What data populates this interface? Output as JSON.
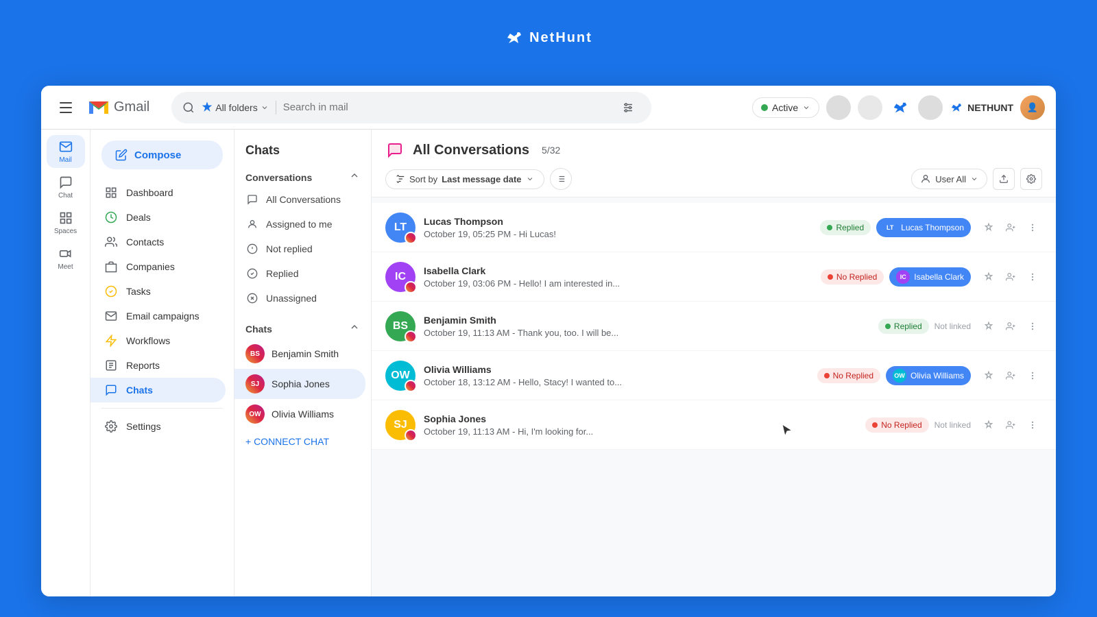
{
  "app": {
    "name": "NetHunt",
    "gmail_label": "Gmail"
  },
  "topbar": {
    "hamburger_label": "Menu",
    "folder_label": "All folders",
    "search_placeholder": "Search in mail",
    "active_label": "Active",
    "nethunt_label": "NETHUNT"
  },
  "left_nav": {
    "items": [
      {
        "id": "mail",
        "label": "Mail",
        "active": true
      },
      {
        "id": "chat",
        "label": "Chat",
        "active": false
      },
      {
        "id": "spaces",
        "label": "Spaces",
        "active": false
      },
      {
        "id": "meet",
        "label": "Meet",
        "active": false
      }
    ]
  },
  "nav_panel": {
    "compose_label": "Compose",
    "items": [
      {
        "id": "dashboard",
        "label": "Dashboard"
      },
      {
        "id": "deals",
        "label": "Deals"
      },
      {
        "id": "contacts",
        "label": "Contacts"
      },
      {
        "id": "companies",
        "label": "Companies"
      },
      {
        "id": "tasks",
        "label": "Tasks"
      },
      {
        "id": "email-campaigns",
        "label": "Email campaigns"
      },
      {
        "id": "workflows",
        "label": "Workflows"
      },
      {
        "id": "reports",
        "label": "Reports"
      },
      {
        "id": "chats",
        "label": "Chats",
        "active": true
      }
    ],
    "settings_label": "Settings"
  },
  "chats_panel": {
    "title": "Chats",
    "conversations_section": "Conversations",
    "chats_section": "Chats",
    "conversation_filters": [
      {
        "id": "all",
        "label": "All Conversations"
      },
      {
        "id": "assigned",
        "label": "Assigned to me"
      },
      {
        "id": "not-replied",
        "label": "Not replied"
      },
      {
        "id": "replied",
        "label": "Replied"
      },
      {
        "id": "unassigned",
        "label": "Unassigned"
      }
    ],
    "chat_users": [
      {
        "id": "benjamin",
        "label": "Benjamin Smith",
        "active": false
      },
      {
        "id": "sophia",
        "label": "Sophia Jones",
        "active": true
      },
      {
        "id": "olivia",
        "label": "Olivia Williams",
        "active": false
      }
    ],
    "connect_chat_label": "+ CONNECT CHAT"
  },
  "conversations_main": {
    "title": "All Conversations",
    "count": "5/32",
    "sort_label": "Sort by",
    "sort_by": "Last message date",
    "user_filter": "User All",
    "conversations": [
      {
        "id": "lucas",
        "name": "Lucas Thompson",
        "timestamp": "October 19, 05:25 PM",
        "preview": "Hi Lucas!",
        "status": "Replied",
        "status_type": "replied",
        "linked_name": "Lucas Thompson",
        "linked": true,
        "initials": "LT",
        "color": "av-blue"
      },
      {
        "id": "isabella",
        "name": "Isabella Clark",
        "timestamp": "October 19, 03:06 PM",
        "preview": "Hello! I am interested in...",
        "status": "No Replied",
        "status_type": "no-replied",
        "linked_name": "Isabella Clark",
        "linked": true,
        "initials": "IC",
        "color": "av-purple"
      },
      {
        "id": "benjamin",
        "name": "Benjamin Smith",
        "timestamp": "October 19, 11:13 AM",
        "preview": "Thank you, too. I will be...",
        "status": "Replied",
        "status_type": "replied",
        "linked_name": null,
        "linked": false,
        "not_linked_label": "Not linked",
        "initials": "BS",
        "color": "av-green"
      },
      {
        "id": "olivia",
        "name": "Olivia Williams",
        "timestamp": "October 18, 13:12 AM",
        "preview": "Hello, Stacy! I wanted to...",
        "status": "No Replied",
        "status_type": "no-replied",
        "linked_name": "Olivia Williams",
        "linked": true,
        "initials": "OW",
        "color": "av-teal"
      },
      {
        "id": "sophia",
        "name": "Sophia Jones",
        "timestamp": "October 19, 11:13 AM",
        "preview": "Hi, I'm looking for...",
        "status": "No Replied",
        "status_type": "no-replied",
        "linked_name": null,
        "linked": false,
        "not_linked_label": "Not linked",
        "initials": "SJ",
        "color": "av-orange"
      }
    ]
  }
}
